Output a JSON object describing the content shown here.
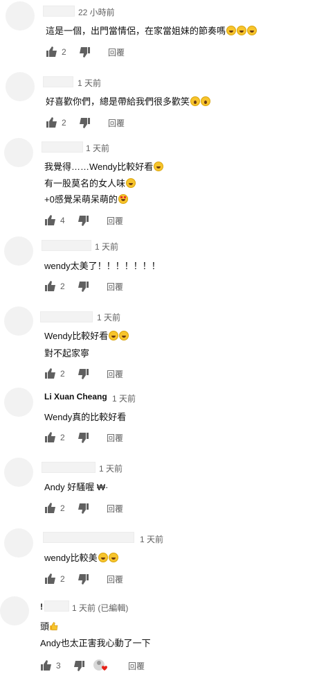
{
  "ui": {
    "reply_label": "回覆"
  },
  "comments": [
    {
      "author": "",
      "time": "22 小時前",
      "lines": [
        "這是一個，出門當情侶，在家當姐妹的節奏嗎"
      ],
      "likes": "2"
    },
    {
      "author": "",
      "time": "1 天前",
      "lines": [
        "好喜歡你們，總是帶給我們很多歡笑"
      ],
      "likes": "2"
    },
    {
      "author": "",
      "time": "1 天前",
      "lines": [
        "我覺得……Wendy比較好看",
        "有一股莫名的女人味",
        "+0感覺呆萌呆萌的"
      ],
      "likes": "4"
    },
    {
      "author": "",
      "time": "1 天前",
      "lines": [
        "wendy太美了！！！！！！！"
      ],
      "likes": "2"
    },
    {
      "author": "",
      "time": "1 天前",
      "lines": [
        "Wendy比較好看",
        "對不起家寧"
      ],
      "likes": "2"
    },
    {
      "author": "Li Xuan Cheang",
      "time": "1 天前",
      "lines": [
        "Wendy真的比較好看"
      ],
      "likes": "2"
    },
    {
      "author": "",
      "time": "1 天前",
      "lines": [
        "Andy 好騷喔 ₩·"
      ],
      "likes": "2"
    },
    {
      "author": "",
      "time": "1 天前",
      "lines": [
        "wendy比較美"
      ],
      "likes": "2"
    },
    {
      "author": "!",
      "time": "1 天前 (已編輯)",
      "lines": [
        "頭",
        "Andy也太正害我心動了一下"
      ],
      "likes": "3"
    }
  ],
  "colors": {
    "secondary_text": "#606060",
    "primary_text": "#0f0f0f",
    "avatar_placeholder": "#f2f2f2"
  }
}
